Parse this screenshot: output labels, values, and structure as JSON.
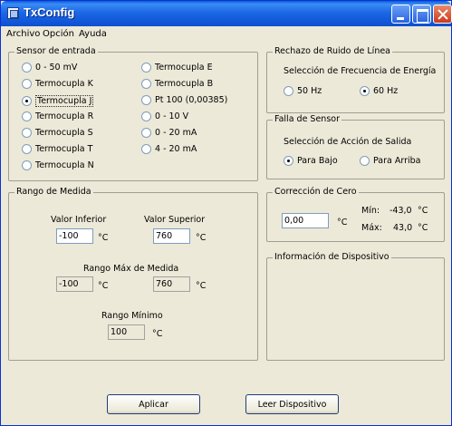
{
  "window": {
    "title": "TxConfig"
  },
  "menu": [
    "Archivo",
    "Opción",
    "Ayuda"
  ],
  "sensor": {
    "title": "Sensor de entrada",
    "options": [
      {
        "label": "0 - 50 mV",
        "selected": false
      },
      {
        "label": "Termocupla K",
        "selected": false
      },
      {
        "label": "Termocupla J",
        "selected": true
      },
      {
        "label": "Termocupla R",
        "selected": false
      },
      {
        "label": "Termocupla S",
        "selected": false
      },
      {
        "label": "Termocupla T",
        "selected": false
      },
      {
        "label": "Termocupla N",
        "selected": false
      },
      {
        "label": "Termocupla E",
        "selected": false
      },
      {
        "label": "Termocupla B",
        "selected": false
      },
      {
        "label": "Pt 100 (0,00385)",
        "selected": false
      },
      {
        "label": "0 - 10 V",
        "selected": false
      },
      {
        "label": "0 - 20 mA",
        "selected": false
      },
      {
        "label": "4 - 20 mA",
        "selected": false
      }
    ]
  },
  "noise": {
    "title": "Rechazo de Ruido de Línea",
    "subtitle": "Selección de Frecuencia de Energía",
    "opt_50": "50 Hz",
    "opt_60": "60 Hz",
    "selected": "60 Hz"
  },
  "fault": {
    "title": "Falla de Sensor",
    "subtitle": "Selección de Acción de Salida",
    "opt_down": "Para Bajo",
    "opt_up": "Para Arriba",
    "selected": "Para Bajo"
  },
  "range": {
    "title": "Rango de Medida",
    "lower_label": "Valor Inferior",
    "upper_label": "Valor Superior",
    "lower_value": "-100",
    "upper_value": "760",
    "unit": "°C",
    "max_label": "Rango Máx de Medida",
    "max_lower": "-100",
    "max_upper": "760",
    "min_label": "Rango Mínimo",
    "min_value": "100"
  },
  "zero": {
    "title": "Corrección de Cero",
    "value": "0,00",
    "unit": "°C",
    "min_label": "Mín:",
    "min_value": "-43,0",
    "max_label": "Máx:",
    "max_value": "43,0"
  },
  "device_info": {
    "title": "Información de Dispositivo"
  },
  "buttons": {
    "apply": "Aplicar",
    "read": "Leer Dispositivo"
  }
}
